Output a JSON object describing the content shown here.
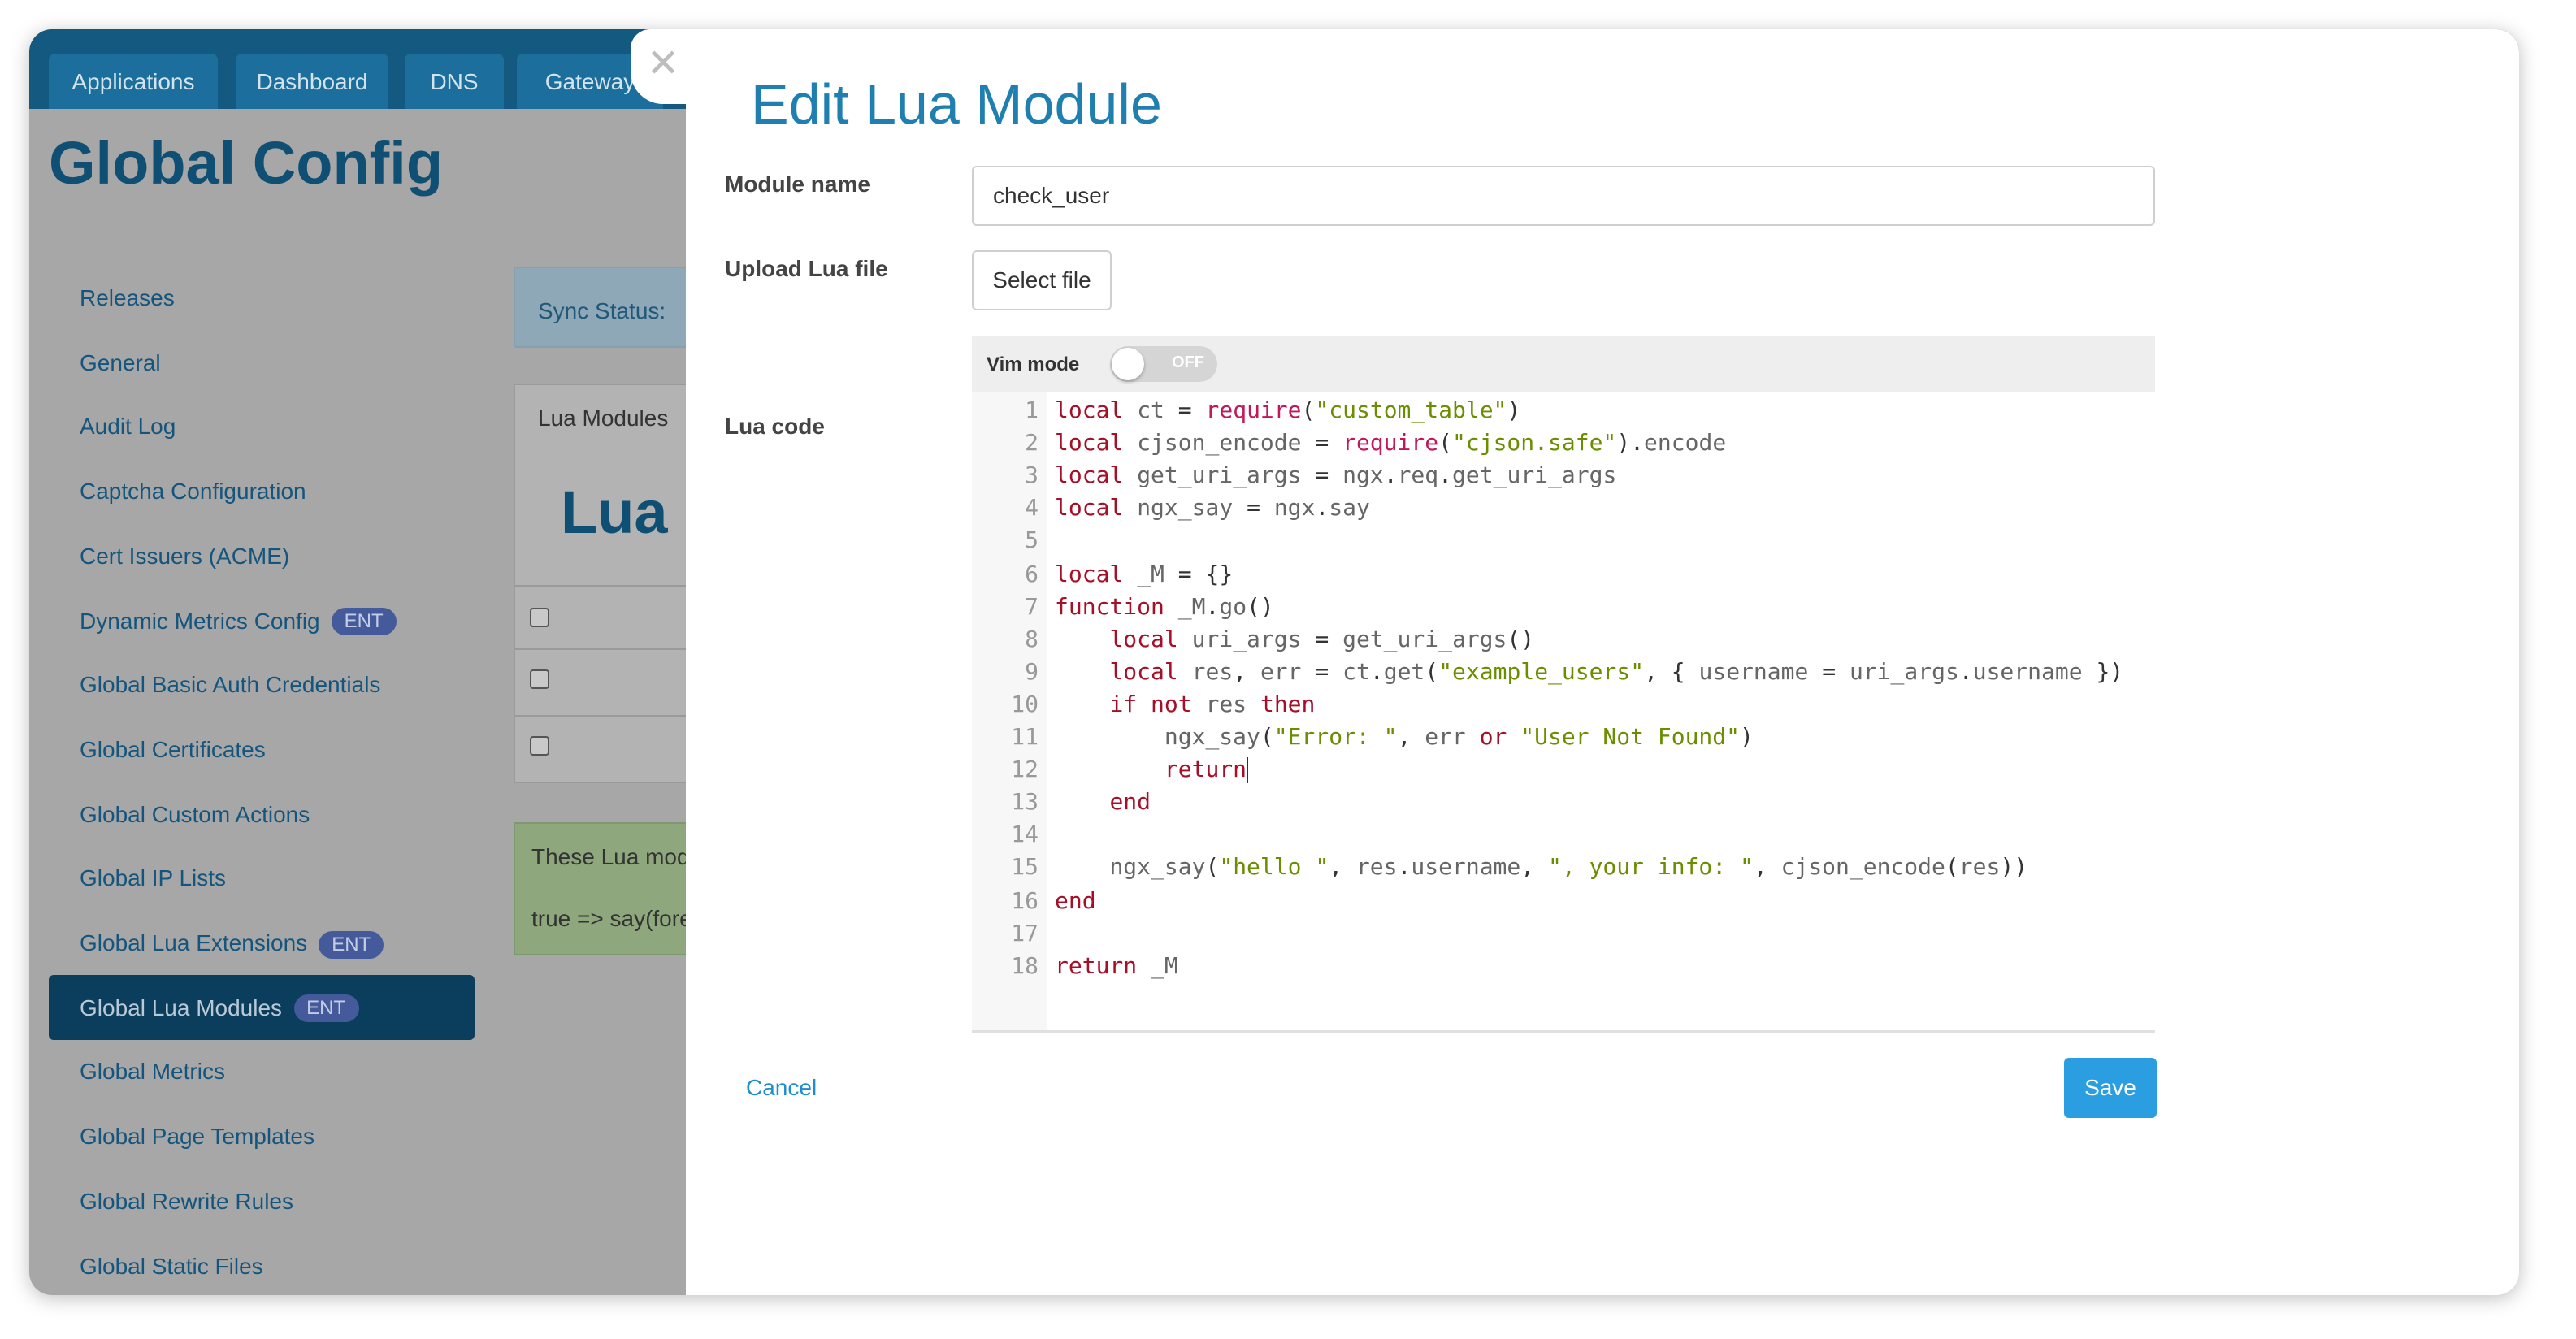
{
  "app": {
    "tabs": [
      "Applications",
      "Dashboard",
      "DNS",
      "Gateway"
    ],
    "page_title": "Global Config",
    "sidebar": {
      "items": [
        {
          "label": "Releases",
          "badge": ""
        },
        {
          "label": "General",
          "badge": ""
        },
        {
          "label": "Audit Log",
          "badge": ""
        },
        {
          "label": "Captcha Configuration",
          "badge": ""
        },
        {
          "label": "Cert Issuers (ACME)",
          "badge": ""
        },
        {
          "label": "Dynamic Metrics Config",
          "badge": "ENT"
        },
        {
          "label": "Global Basic Auth Credentials",
          "badge": ""
        },
        {
          "label": "Global Certificates",
          "badge": ""
        },
        {
          "label": "Global Custom Actions",
          "badge": ""
        },
        {
          "label": "Global IP Lists",
          "badge": ""
        },
        {
          "label": "Global Lua Extensions",
          "badge": "ENT"
        },
        {
          "label": "Global Lua Modules",
          "badge": "ENT",
          "active": true
        },
        {
          "label": "Global Metrics",
          "badge": ""
        },
        {
          "label": "Global Page Templates",
          "badge": ""
        },
        {
          "label": "Global Rewrite Rules",
          "badge": ""
        },
        {
          "label": "Global Static Files",
          "badge": ""
        }
      ]
    },
    "sync_status_label": "Sync Status:",
    "panel": {
      "tab_label": "Lua Modules",
      "heading": "Lua I"
    },
    "note": {
      "line1": "These Lua mod",
      "line2": "true => say(fore"
    }
  },
  "modal": {
    "close_symbol": "✕",
    "title": "Edit Lua Module",
    "module_name_label": "Module name",
    "module_name_value": "check_user",
    "upload_label": "Upload Lua file",
    "select_file_label": "Select file",
    "lua_code_label": "Lua code",
    "vim_mode_label": "Vim mode",
    "vim_mode_state": "OFF",
    "vim_mode_on": false,
    "cancel_label": "Cancel",
    "save_label": "Save",
    "code_lines": [
      {
        "n": "1",
        "text": "local ct = require(\"custom_table\")"
      },
      {
        "n": "2",
        "text": "local cjson_encode = require(\"cjson.safe\").encode"
      },
      {
        "n": "3",
        "text": "local get_uri_args = ngx.req.get_uri_args"
      },
      {
        "n": "4",
        "text": "local ngx_say = ngx.say"
      },
      {
        "n": "5",
        "text": ""
      },
      {
        "n": "6",
        "text": "local _M = {}"
      },
      {
        "n": "7",
        "text": "function _M.go()"
      },
      {
        "n": "8",
        "text": "    local uri_args = get_uri_args()"
      },
      {
        "n": "9",
        "text": "    local res, err = ct.get(\"example_users\", { username = uri_args.username })"
      },
      {
        "n": "10",
        "text": "    if not res then"
      },
      {
        "n": "11",
        "text": "        ngx_say(\"Error: \", err or \"User Not Found\")"
      },
      {
        "n": "12",
        "text": "        return"
      },
      {
        "n": "13",
        "text": "    end"
      },
      {
        "n": "14",
        "text": ""
      },
      {
        "n": "15",
        "text": "    ngx_say(\"hello \", res.username, \", your info: \", cjson_encode(res))"
      },
      {
        "n": "16",
        "text": "end"
      },
      {
        "n": "17",
        "text": ""
      },
      {
        "n": "18",
        "text": "return _M"
      }
    ]
  },
  "colors": {
    "accent": "#1f7fb0",
    "save_button": "#2a9ee0",
    "header_bar": "#14597f",
    "keyword": "#a50f27",
    "builtin_fn": "#c2185b",
    "string": "#6b8e00"
  }
}
